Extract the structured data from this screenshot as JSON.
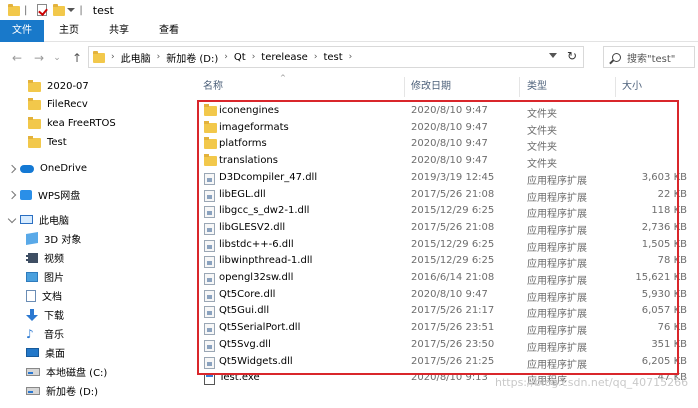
{
  "window": {
    "title": "test",
    "quick_separator": "|"
  },
  "ribbon": {
    "tabs": [
      "文件",
      "主页",
      "共享",
      "查看"
    ],
    "active_color": "#1979ca"
  },
  "address": {
    "crumbs": [
      "此电脑",
      "新加卷 (D:)",
      "Qt",
      "terelease",
      "test"
    ],
    "separator": "›",
    "search_placeholder": "搜索\"test\""
  },
  "nav": {
    "back": "←",
    "forward": "→",
    "recent": "⌄",
    "up": "↑",
    "refresh": "↻"
  },
  "sidebar": {
    "items": [
      {
        "label": "2020-07",
        "icon": "folder-icon"
      },
      {
        "label": "FileRecv",
        "icon": "folder-icon"
      },
      {
        "label": "kea FreeRTOS",
        "icon": "folder-icon"
      },
      {
        "label": "Test",
        "icon": "folder-icon"
      },
      {
        "label": "OneDrive",
        "icon": "cloud-icon"
      },
      {
        "label": "WPS网盘",
        "icon": "wps-cloud-icon"
      },
      {
        "label": "此电脑",
        "icon": "computer-icon"
      },
      {
        "label": "3D 对象",
        "icon": "3d-objects-icon"
      },
      {
        "label": "视频",
        "icon": "video-icon"
      },
      {
        "label": "图片",
        "icon": "pictures-icon"
      },
      {
        "label": "文档",
        "icon": "documents-icon"
      },
      {
        "label": "下载",
        "icon": "download-icon"
      },
      {
        "label": "音乐",
        "icon": "music-icon"
      },
      {
        "label": "桌面",
        "icon": "desktop-icon"
      },
      {
        "label": "本地磁盘 (C:)",
        "icon": "drive-icon"
      },
      {
        "label": "新加卷 (D:)",
        "icon": "drive-icon"
      }
    ]
  },
  "columns": {
    "name": "名称",
    "date": "修改日期",
    "type": "类型",
    "size": "大小",
    "sort_indicator": "^"
  },
  "files": [
    {
      "name": "iconengines",
      "date": "2020/8/10 9:47",
      "type": "文件夹",
      "size": "",
      "kind": "folder"
    },
    {
      "name": "imageformats",
      "date": "2020/8/10 9:47",
      "type": "文件夹",
      "size": "",
      "kind": "folder"
    },
    {
      "name": "platforms",
      "date": "2020/8/10 9:47",
      "type": "文件夹",
      "size": "",
      "kind": "folder"
    },
    {
      "name": "translations",
      "date": "2020/8/10 9:47",
      "type": "文件夹",
      "size": "",
      "kind": "folder"
    },
    {
      "name": "D3Dcompiler_47.dll",
      "date": "2019/3/19 12:45",
      "type": "应用程序扩展",
      "size": "3,603 KB",
      "kind": "dll"
    },
    {
      "name": "libEGL.dll",
      "date": "2017/5/26 21:08",
      "type": "应用程序扩展",
      "size": "22 KB",
      "kind": "dll"
    },
    {
      "name": "libgcc_s_dw2-1.dll",
      "date": "2015/12/29 6:25",
      "type": "应用程序扩展",
      "size": "118 KB",
      "kind": "dll"
    },
    {
      "name": "libGLESV2.dll",
      "date": "2017/5/26 21:08",
      "type": "应用程序扩展",
      "size": "2,736 KB",
      "kind": "dll"
    },
    {
      "name": "libstdc++-6.dll",
      "date": "2015/12/29 6:25",
      "type": "应用程序扩展",
      "size": "1,505 KB",
      "kind": "dll"
    },
    {
      "name": "libwinpthread-1.dll",
      "date": "2015/12/29 6:25",
      "type": "应用程序扩展",
      "size": "78 KB",
      "kind": "dll"
    },
    {
      "name": "opengl32sw.dll",
      "date": "2016/6/14 21:08",
      "type": "应用程序扩展",
      "size": "15,621 KB",
      "kind": "dll"
    },
    {
      "name": "Qt5Core.dll",
      "date": "2020/8/10 9:47",
      "type": "应用程序扩展",
      "size": "5,930 KB",
      "kind": "dll"
    },
    {
      "name": "Qt5Gui.dll",
      "date": "2017/5/26 21:17",
      "type": "应用程序扩展",
      "size": "6,057 KB",
      "kind": "dll"
    },
    {
      "name": "Qt5SerialPort.dll",
      "date": "2017/5/26 23:51",
      "type": "应用程序扩展",
      "size": "76 KB",
      "kind": "dll"
    },
    {
      "name": "Qt5Svg.dll",
      "date": "2017/5/26 23:50",
      "type": "应用程序扩展",
      "size": "351 KB",
      "kind": "dll"
    },
    {
      "name": "Qt5Widgets.dll",
      "date": "2017/5/26 21:25",
      "type": "应用程序扩展",
      "size": "6,205 KB",
      "kind": "dll"
    },
    {
      "name": "Test.exe",
      "date": "2020/8/10 9:13",
      "type": "应用程序",
      "size": "47 KB",
      "kind": "exe"
    }
  ],
  "highlight_color": "#d9262b",
  "watermark": "https://blog.csdn.net/qq_40715266"
}
